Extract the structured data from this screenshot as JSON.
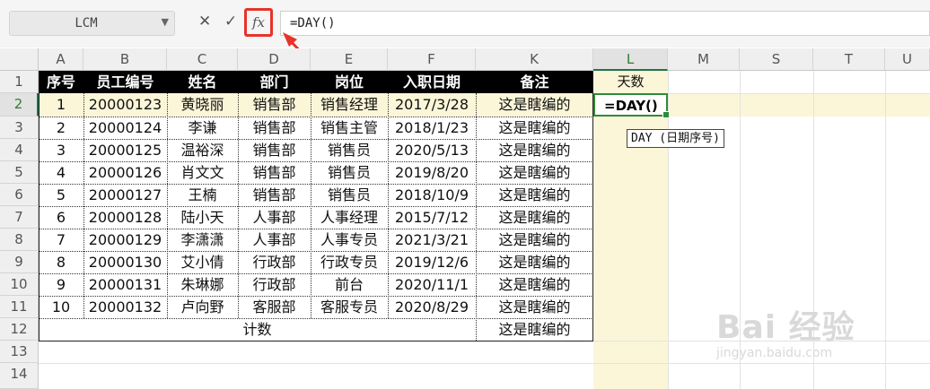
{
  "formula_bar": {
    "name_box": "LCM",
    "cancel_icon": "✕",
    "confirm_icon": "✓",
    "fx_label": "fx",
    "formula": "=DAY()"
  },
  "sheet": {
    "columns": [
      "A",
      "B",
      "C",
      "D",
      "E",
      "F",
      "K",
      "L",
      "M",
      "S",
      "T",
      "U"
    ],
    "rows": [
      "1",
      "2",
      "3",
      "4",
      "5",
      "6",
      "7",
      "8",
      "9",
      "10",
      "11",
      "12",
      "13",
      "14"
    ],
    "headers": [
      "序号",
      "员工编号",
      "姓名",
      "部门",
      "岗位",
      "入职日期",
      "备注"
    ],
    "L1": "天数",
    "data": [
      [
        "1",
        "20000123",
        "黄晓丽",
        "销售部",
        "销售经理",
        "2017/3/28",
        "这是瞎编的"
      ],
      [
        "2",
        "20000124",
        "李谦",
        "销售部",
        "销售主管",
        "2018/1/23",
        "这是瞎编的"
      ],
      [
        "3",
        "20000125",
        "温裕深",
        "销售部",
        "销售员",
        "2020/5/13",
        "这是瞎编的"
      ],
      [
        "4",
        "20000126",
        "肖文文",
        "销售部",
        "销售员",
        "2019/8/20",
        "这是瞎编的"
      ],
      [
        "5",
        "20000127",
        "王楠",
        "销售部",
        "销售员",
        "2018/10/9",
        "这是瞎编的"
      ],
      [
        "6",
        "20000128",
        "陆小天",
        "人事部",
        "人事经理",
        "2015/7/12",
        "这是瞎编的"
      ],
      [
        "7",
        "20000129",
        "李潇潇",
        "人事部",
        "人事专员",
        "2021/3/21",
        "这是瞎编的"
      ],
      [
        "8",
        "20000130",
        "艾小倩",
        "行政部",
        "行政专员",
        "2019/12/6",
        "这是瞎编的"
      ],
      [
        "9",
        "20000131",
        "朱琳娜",
        "行政部",
        "前台",
        "2020/11/1",
        "这是瞎编的"
      ],
      [
        "10",
        "20000132",
        "卢向野",
        "客服部",
        "客服专员",
        "2020/8/29",
        "这是瞎编的"
      ]
    ],
    "row12_label": "计数",
    "row12_note": "这是瞎编的",
    "active_cell_text": "=DAY()",
    "tooltip": "DAY (日期序号)"
  },
  "watermark": {
    "main": "Bai 经验",
    "sub": "jingyan.baidu.com"
  },
  "colors": {
    "accent_red": "#e8322b",
    "selection_green": "#2e8b3a",
    "highlight": "#fbf6d8"
  }
}
